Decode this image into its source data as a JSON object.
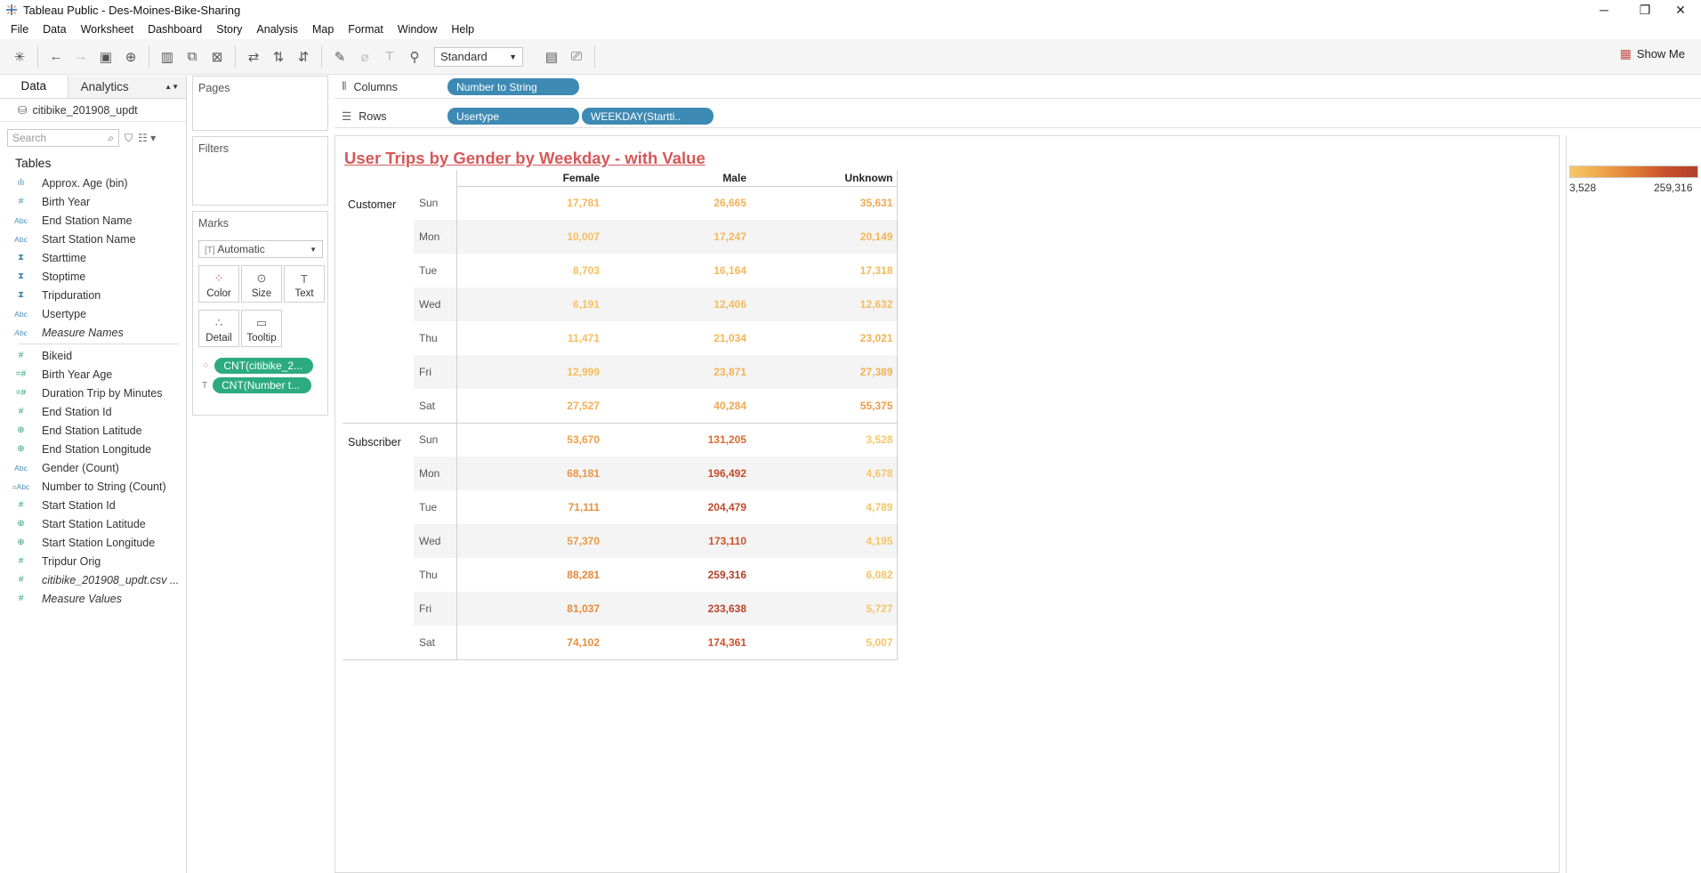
{
  "window": {
    "title": "Tableau Public - Des-Moines-Bike-Sharing",
    "minimize": "─",
    "restore": "❐",
    "close": "✕"
  },
  "menu": [
    "File",
    "Data",
    "Worksheet",
    "Dashboard",
    "Story",
    "Analysis",
    "Map",
    "Format",
    "Window",
    "Help"
  ],
  "toolbar": {
    "fit": "Standard",
    "show_me": "Show Me"
  },
  "data_pane": {
    "tab_data": "Data",
    "tab_analytics": "Analytics",
    "datasource": "citibike_201908_updt",
    "search_placeholder": "Search",
    "tables_heading": "Tables",
    "dimensions": [
      {
        "icon": "bin-icon",
        "label": "Approx. Age (bin)"
      },
      {
        "icon": "hash-icon",
        "label": "Birth Year"
      },
      {
        "icon": "abc-icon",
        "label": "End Station Name"
      },
      {
        "icon": "abc-icon",
        "label": "Start Station Name"
      },
      {
        "icon": "datetime-icon",
        "label": "Starttime"
      },
      {
        "icon": "datetime-icon",
        "label": "Stoptime"
      },
      {
        "icon": "datetime-icon",
        "label": "Tripduration"
      },
      {
        "icon": "abc-icon",
        "label": "Usertype"
      },
      {
        "icon": "abc-icon",
        "label": "Measure Names"
      }
    ],
    "measures": [
      {
        "icon": "hash-icon",
        "label": "Bikeid"
      },
      {
        "icon": "calc-hash-icon",
        "label": "Birth Year Age"
      },
      {
        "icon": "calc-hash-icon",
        "label": "Duration Trip by Minutes"
      },
      {
        "icon": "hash-icon",
        "label": "End Station Id"
      },
      {
        "icon": "globe-icon",
        "label": "End Station Latitude"
      },
      {
        "icon": "globe-icon",
        "label": "End Station Longitude"
      },
      {
        "icon": "abc-icon",
        "label": "Gender (Count)"
      },
      {
        "icon": "calc-abc-icon",
        "label": "Number to String (Count)"
      },
      {
        "icon": "hash-icon",
        "label": "Start Station Id"
      },
      {
        "icon": "globe-icon",
        "label": "Start Station Latitude"
      },
      {
        "icon": "globe-icon",
        "label": "Start Station Longitude"
      },
      {
        "icon": "hash-icon",
        "label": "Tripdur Orig"
      },
      {
        "icon": "hash-icon",
        "label": "citibike_201908_updt.csv ..."
      },
      {
        "icon": "hash-icon",
        "label": "Measure Values"
      }
    ]
  },
  "cards": {
    "pages": "Pages",
    "filters": "Filters",
    "marks": "Marks",
    "mark_type": "Automatic",
    "buttons": [
      "Color",
      "Size",
      "Text",
      "Detail",
      "Tooltip"
    ],
    "pills": [
      "CNT(citibike_2...",
      "CNT(Number t..."
    ]
  },
  "shelves": {
    "columns_label": "Columns",
    "columns_pill": "Number to String",
    "rows_label": "Rows",
    "rows_pills": [
      "Usertype",
      "WEEKDAY(Startti.."
    ]
  },
  "view_title": "User Trips by Gender by Weekday - with Value",
  "legend": {
    "min_label": "3,528",
    "max_label": "259,316",
    "colors": [
      "#f7c766",
      "#b0402a"
    ]
  },
  "chart_data": {
    "type": "table",
    "title": "User Trips by Gender by Weekday - with Value",
    "columns": [
      "Female",
      "Male",
      "Unknown"
    ],
    "groups": [
      {
        "usertype": "Customer",
        "rows": [
          {
            "weekday": "Sun",
            "values": [
              17781,
              26665,
              35631
            ],
            "labels": [
              "17,781",
              "26,665",
              "35,631"
            ]
          },
          {
            "weekday": "Mon",
            "values": [
              10007,
              17247,
              20149
            ],
            "labels": [
              "10,007",
              "17,247",
              "20,149"
            ]
          },
          {
            "weekday": "Tue",
            "values": [
              8703,
              16164,
              17318
            ],
            "labels": [
              "8,703",
              "16,164",
              "17,318"
            ]
          },
          {
            "weekday": "Wed",
            "values": [
              6191,
              12406,
              12632
            ],
            "labels": [
              "6,191",
              "12,406",
              "12,632"
            ]
          },
          {
            "weekday": "Thu",
            "values": [
              11471,
              21034,
              23021
            ],
            "labels": [
              "11,471",
              "21,034",
              "23,021"
            ]
          },
          {
            "weekday": "Fri",
            "values": [
              12999,
              23871,
              27389
            ],
            "labels": [
              "12,999",
              "23,871",
              "27,389"
            ]
          },
          {
            "weekday": "Sat",
            "values": [
              27527,
              40284,
              55375
            ],
            "labels": [
              "27,527",
              "40,284",
              "55,375"
            ]
          }
        ]
      },
      {
        "usertype": "Subscriber",
        "rows": [
          {
            "weekday": "Sun",
            "values": [
              53670,
              131205,
              3528
            ],
            "labels": [
              "53,670",
              "131,205",
              "3,528"
            ]
          },
          {
            "weekday": "Mon",
            "values": [
              68181,
              196492,
              4678
            ],
            "labels": [
              "68,181",
              "196,492",
              "4,678"
            ]
          },
          {
            "weekday": "Tue",
            "values": [
              71111,
              204479,
              4789
            ],
            "labels": [
              "71,111",
              "204,479",
              "4,789"
            ]
          },
          {
            "weekday": "Wed",
            "values": [
              57370,
              173110,
              4195
            ],
            "labels": [
              "57,370",
              "173,110",
              "4,195"
            ]
          },
          {
            "weekday": "Thu",
            "values": [
              88281,
              259316,
              6082
            ],
            "labels": [
              "88,281",
              "259,316",
              "6,082"
            ]
          },
          {
            "weekday": "Fri",
            "values": [
              81037,
              233638,
              5727
            ],
            "labels": [
              "81,037",
              "233,638",
              "5,727"
            ]
          },
          {
            "weekday": "Sat",
            "values": [
              74102,
              174361,
              5007
            ],
            "labels": [
              "74,102",
              "174,361",
              "5,007"
            ]
          }
        ]
      }
    ],
    "color_range": [
      3528,
      259316
    ]
  }
}
